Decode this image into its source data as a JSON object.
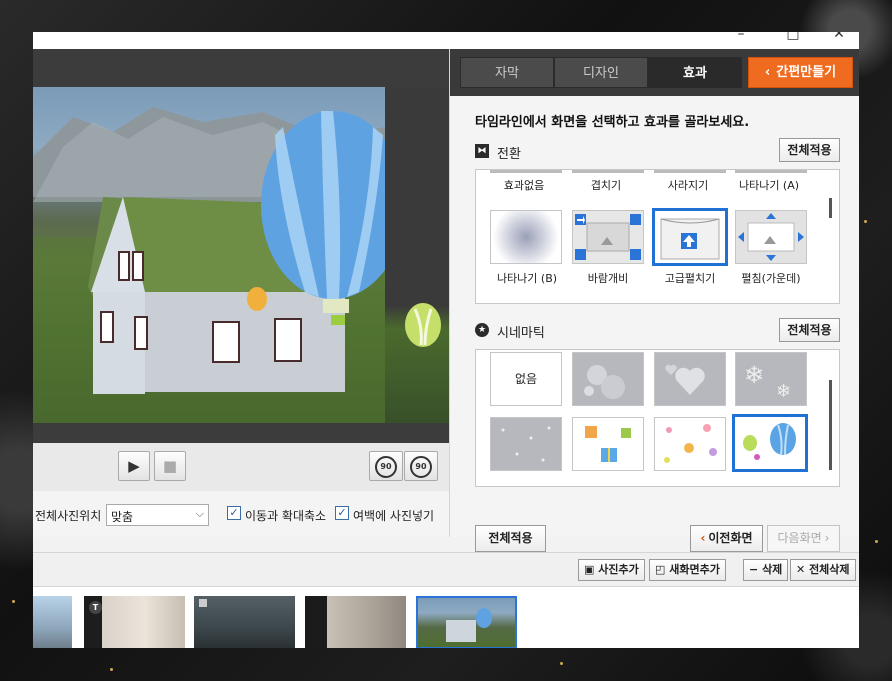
{
  "window": {
    "minimize": "–",
    "maximize": "□",
    "close": "✕"
  },
  "tabs": [
    {
      "label": "자막",
      "active": false
    },
    {
      "label": "디자인",
      "active": false
    },
    {
      "label": "효과",
      "active": true
    }
  ],
  "easy_make": {
    "label": "간편만들기",
    "icon": "chevron-left-icon"
  },
  "instruction": "타임라인에서 화면을 선택하고 효과를 골라보세요.",
  "transition": {
    "title": "전환",
    "apply_label": "전체적용",
    "top_captions": [
      "효과없음",
      "겹치기",
      "사라지기",
      "나타나기 (A)"
    ],
    "items": [
      {
        "caption": "나타나기 (B)",
        "icon": "radial-fade-icon"
      },
      {
        "caption": "바람개비",
        "icon": "pinwheel-icon"
      },
      {
        "caption": "고급펼치기",
        "icon": "page-unfold-icon",
        "selected": true
      },
      {
        "caption": "펼침(가운데)",
        "icon": "expand-center-icon"
      }
    ]
  },
  "cinematic": {
    "title": "시네마틱",
    "apply_label": "전체적용",
    "items": [
      {
        "label": "없음",
        "icon": "none"
      },
      {
        "icon": "bubbles-icon"
      },
      {
        "icon": "hearts-icon"
      },
      {
        "icon": "snowflakes-icon"
      },
      {
        "icon": "dots-icon"
      },
      {
        "icon": "gift-boxes-icon"
      },
      {
        "icon": "flowers-icon"
      },
      {
        "icon": "balloons-icon",
        "selected": true
      }
    ]
  },
  "nav": {
    "apply_all": "전체적용",
    "prev": "이전화면",
    "next": "다음화면"
  },
  "playback": {
    "play": "▶",
    "stop": "■",
    "rotate_left": "90",
    "rotate_right": "90"
  },
  "photo_position": {
    "label": "전체사진위치",
    "fit_value": "맞춤",
    "pan_zoom_label": "이동과 확대축소",
    "pan_zoom_checked": true,
    "fill_margin_label": "여백에 사진넣기",
    "fill_margin_checked": true
  },
  "timeline_toolbar": {
    "add_photo": "사진추가",
    "new_screen": "새화면추가",
    "delete": "삭제",
    "delete_all": "전체삭제"
  },
  "timeline": {
    "thumbs": [
      {
        "name": "city"
      },
      {
        "name": "doorway",
        "badge": "T"
      },
      {
        "name": "heron"
      },
      {
        "name": "window"
      },
      {
        "name": "house-balloon",
        "selected": true
      }
    ]
  },
  "colors": {
    "accent_orange": "#ef6b1f",
    "selection_blue": "#1f72d4",
    "tab_bar": "#3a3a3a"
  }
}
